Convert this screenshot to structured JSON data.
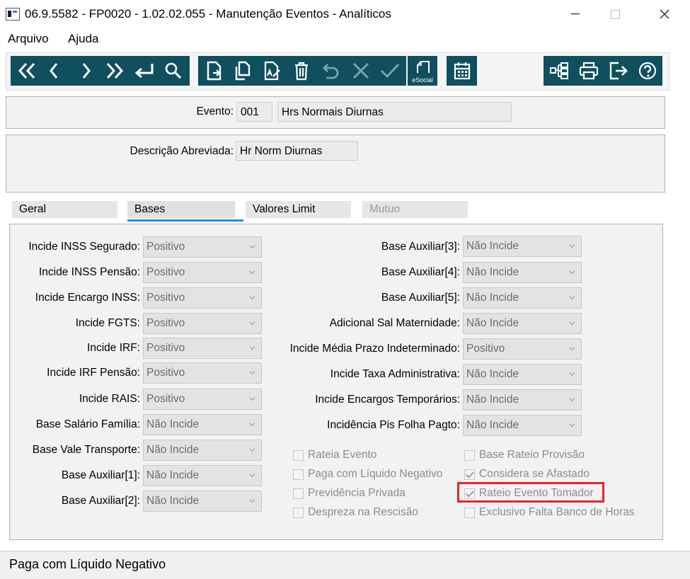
{
  "window": {
    "title": "06.9.5582 - FP0020 - 1.02.02.055 - Manutenção Eventos - Analíticos"
  },
  "menu": {
    "items": [
      "Arquivo",
      "Ajuda"
    ]
  },
  "toolbar": {
    "esocial_label": "eSocial",
    "accent_color": "#0f4f5e"
  },
  "header": {
    "evento_label": "Evento:",
    "evento_code": "001",
    "evento_name": "Hrs Normais Diurnas",
    "descricao_label": "Descrição Abreviada:",
    "descricao_value": "Hr Norm Diurnas"
  },
  "tabs": [
    {
      "label": "Geral"
    },
    {
      "label": "Bases"
    },
    {
      "label": "Valores Limit"
    },
    {
      "label": "Mutuo"
    }
  ],
  "left_fields": [
    {
      "label": "Incide INSS Segurado:",
      "value": "Positivo"
    },
    {
      "label": "Incide INSS Pensão:",
      "value": "Positivo"
    },
    {
      "label": "Incide Encargo INSS:",
      "value": "Positivo"
    },
    {
      "label": "Incide FGTS:",
      "value": "Positivo"
    },
    {
      "label": "Incide IRF:",
      "value": "Positivo"
    },
    {
      "label": "Incide IRF Pensão:",
      "value": "Positivo"
    },
    {
      "label": "Incide RAIS:",
      "value": "Positivo"
    },
    {
      "label": "Base Salário Família:",
      "value": "Não Incide"
    },
    {
      "label": "Base Vale Transporte:",
      "value": "Não Incide"
    },
    {
      "label": "Base Auxiliar[1]:",
      "value": "Não Incide"
    },
    {
      "label": "Base Auxiliar[2]:",
      "value": "Não Incide"
    }
  ],
  "right_fields": [
    {
      "label": "Base Auxiliar[3]:",
      "value": "Não Incide"
    },
    {
      "label": "Base Auxiliar[4]:",
      "value": "Não Incide"
    },
    {
      "label": "Base Auxiliar[5]:",
      "value": "Não Incide"
    },
    {
      "label": "Adicional Sal Maternidade:",
      "value": "Não Incide"
    },
    {
      "label": "Incide Média Prazo Indeterminado:",
      "value": "Positivo"
    },
    {
      "label": "Incide Taxa Administrativa:",
      "value": "Não Incide"
    },
    {
      "label": "Incide Encargos Temporários:",
      "value": "Não Incide"
    },
    {
      "label": "Incidência Pis Folha Pagto:",
      "value": "Não Incide"
    }
  ],
  "checkboxes_left": [
    {
      "label": "Rateia Evento",
      "checked": false
    },
    {
      "label": "Paga com Líquido Negativo",
      "checked": false
    },
    {
      "label": "Previdência Privada",
      "checked": false
    },
    {
      "label": "Despreza na Rescisão",
      "checked": false
    }
  ],
  "checkboxes_right": [
    {
      "label": "Base Rateio Provisão",
      "checked": false
    },
    {
      "label": "Considera se Afastado",
      "checked": true
    },
    {
      "label": "Rateio Evento Tomador",
      "checked": true
    },
    {
      "label": "Exclusivo Falta Banco de Horas",
      "checked": false
    }
  ],
  "status": {
    "text": "Paga com Líquido Negativo"
  },
  "highlight_color": "#e0262b"
}
